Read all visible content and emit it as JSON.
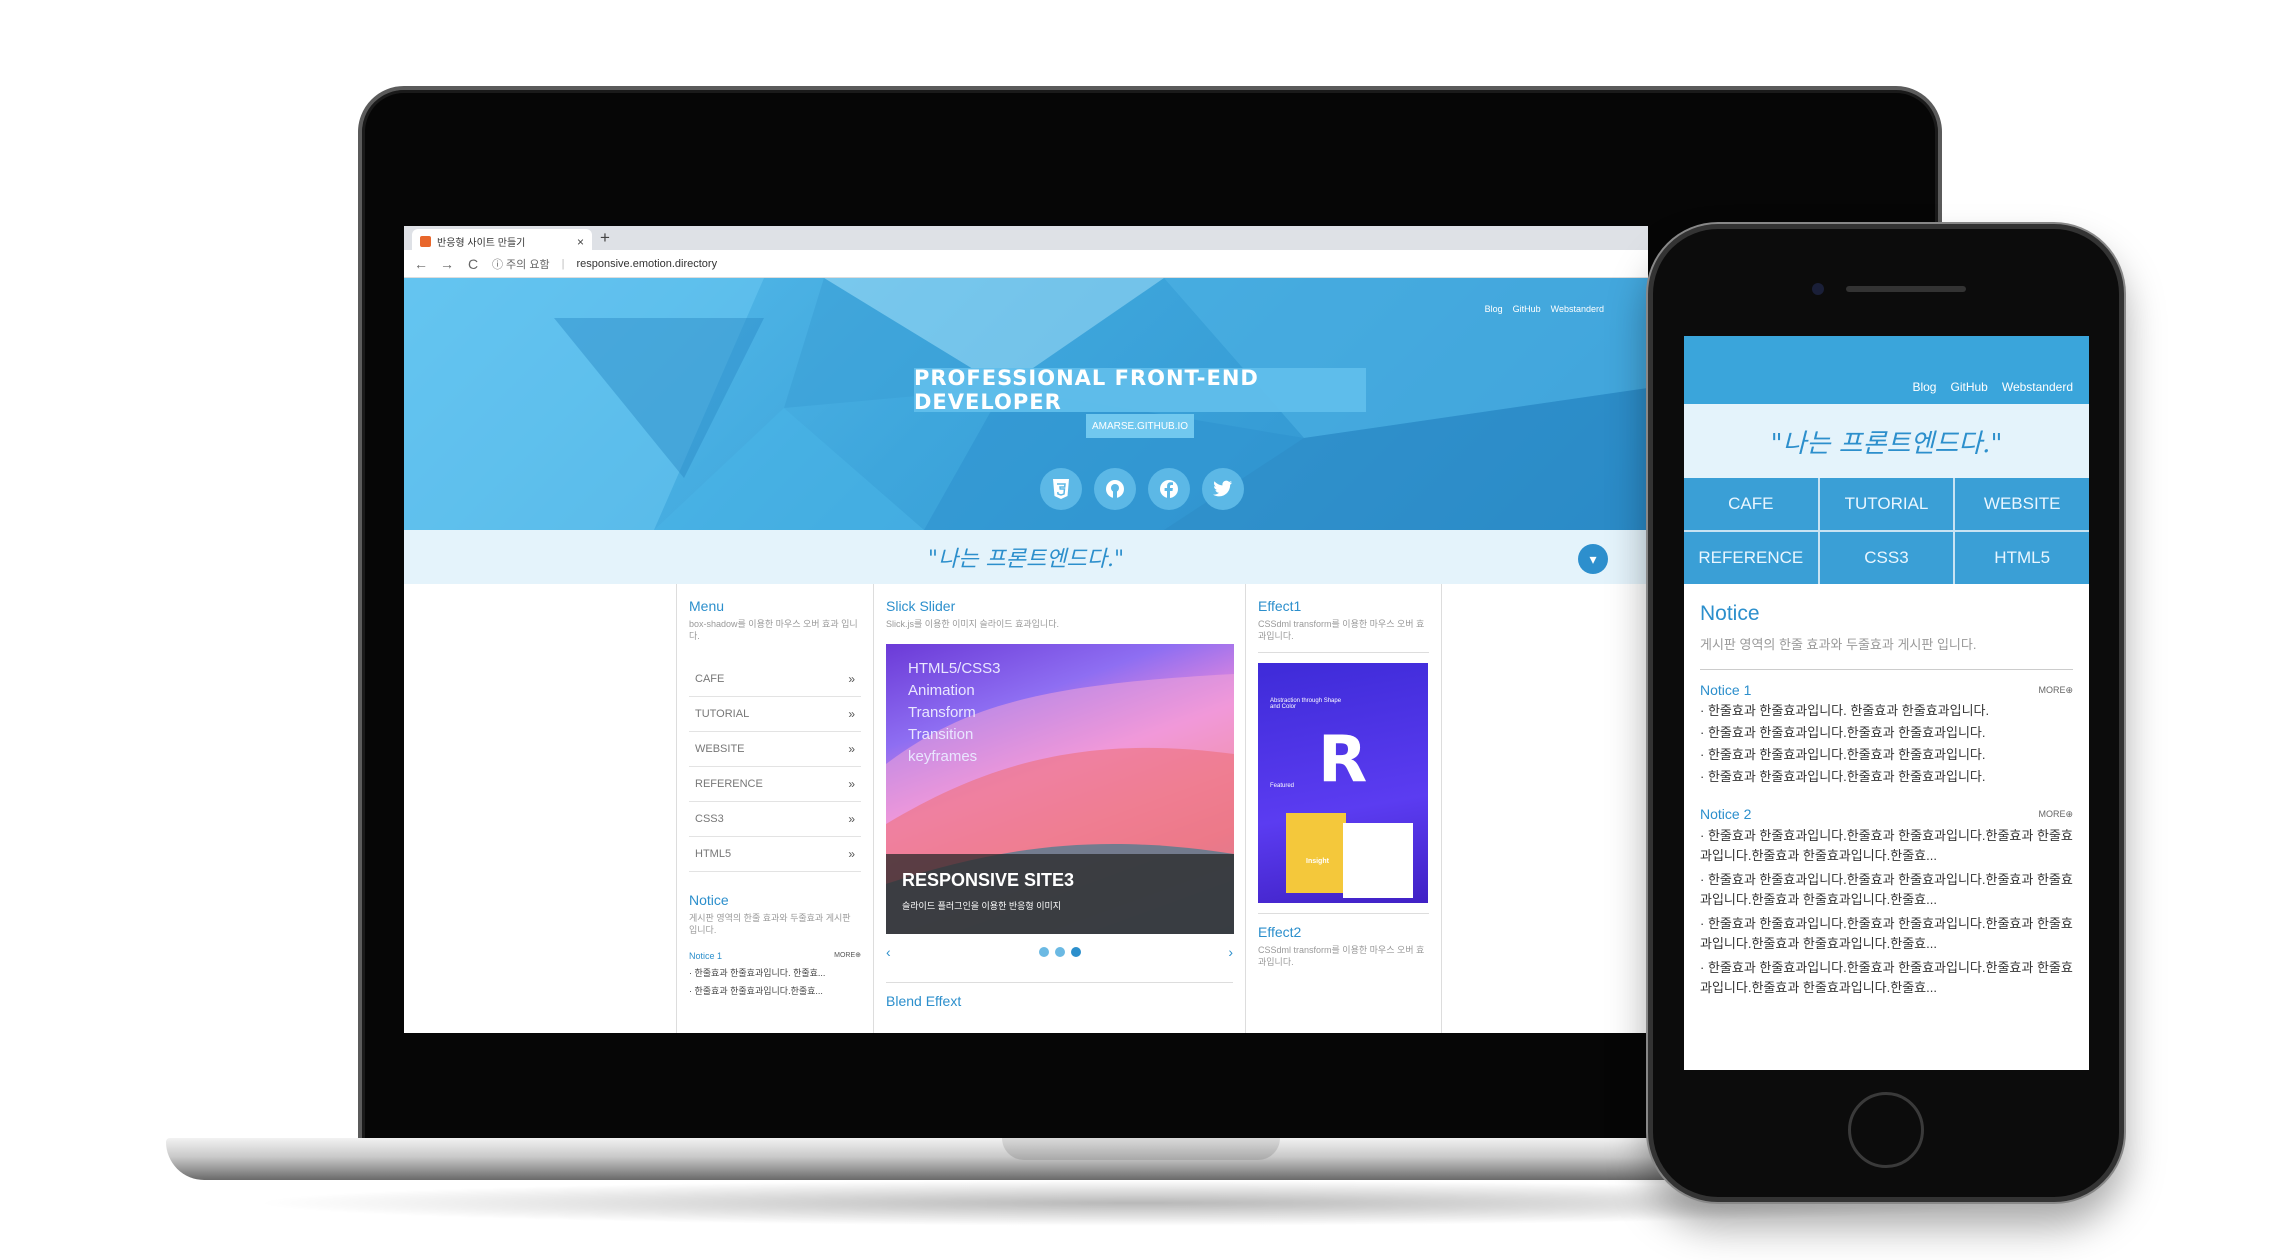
{
  "browser": {
    "tab_title": "반응형 사이트 만들기",
    "tab_close": "×",
    "new_tab": "+",
    "back": "←",
    "forward": "→",
    "reload": "C",
    "security_label": "ⓘ 주의 요함",
    "url_separator": "|",
    "url": "responsive.emotion.directory"
  },
  "site": {
    "links": [
      "Blog",
      "GitHub",
      "Webstanderd"
    ],
    "hero_title": "PROFESSIONAL FRONT-END DEVELOPER",
    "hero_subtitle": "AMARSE.GITHUB.IO",
    "social_icons": [
      "html5-icon",
      "github-icon",
      "facebook-icon",
      "twitter-icon"
    ],
    "slogan": "\"나는 프론트엔드다.\"",
    "toggle_icon": "chevron-down-icon"
  },
  "menu_box": {
    "title": "Menu",
    "desc": "box-shadow를 이용한 마우스 오버 효과 입니다.",
    "items": [
      "CAFE",
      "TUTORIAL",
      "WEBSITE",
      "REFERENCE",
      "CSS3",
      "HTML5"
    ],
    "arrow": "»"
  },
  "notice_box": {
    "title": "Notice",
    "desc": "게시판 영역의 한줄 효과와 두줄효과 게시판 입니다.",
    "sub_title": "Notice 1",
    "more": "MORE⊕",
    "lines": [
      "· 한줄효과 한줄효과입니다. 한줄효...",
      "· 한줄효과 한줄효과입니다.한줄효..."
    ]
  },
  "slider_box": {
    "title": "Slick Slider",
    "desc": "Slick.js를 이용한 이미지 슬라이드 효과입니다.",
    "image_lines": [
      "HTML5/CSS3",
      "Animation",
      "Transform",
      "Transition",
      "keyframes"
    ],
    "caption_title": "RESPONSIVE SITE3",
    "caption_sub": "슬라이드 플러그인을 이용한 반응형 이미지",
    "prev": "‹",
    "next": "›",
    "dots": 3,
    "active_dot": 2
  },
  "blend_box": {
    "title": "Blend  Effext"
  },
  "effect_box": {
    "title": "Effect1",
    "desc": "CSSdml transform를 이용한 마우스 오버 효과입니다.",
    "img_text": "Abstraction through Shape and Color",
    "img_featured": "Featured",
    "img_insight": "Insight",
    "title2": "Effect2",
    "desc2": "CSSdml transform를 이용한 마우스 오버 효과입니다."
  },
  "phone": {
    "links": [
      "Blog",
      "GitHub",
      "Webstanderd"
    ],
    "slogan": "\"나는 프론트엔드다.\"",
    "menu": [
      "CAFE",
      "TUTORIAL",
      "WEBSITE",
      "REFERENCE",
      "CSS3",
      "HTML5"
    ],
    "notice_title": "Notice",
    "notice_desc": "게시판 영역의 한줄 효과와 두줄효과 게시판 입니다.",
    "notice1_title": "Notice 1",
    "notice2_title": "Notice 2",
    "more": "MORE⊕",
    "notice1_rows": [
      "· 한줄효과 한줄효과입니다. 한줄효과 한줄효과입니다.",
      "· 한줄효과 한줄효과입니다.한줄효과 한줄효과입니다.",
      "· 한줄효과 한줄효과입니다.한줄효과 한줄효과입니다.",
      "· 한줄효과 한줄효과입니다.한줄효과 한줄효과입니다."
    ],
    "notice2_rows": [
      "· 한줄효과 한줄효과입니다.한줄효과 한줄효과입니다.한줄효과 한줄효과입니다.한줄효과 한줄효과입니다.한줄효...",
      "· 한줄효과 한줄효과입니다.한줄효과 한줄효과입니다.한줄효과 한줄효과입니다.한줄효과 한줄효과입니다.한줄효...",
      "· 한줄효과 한줄효과입니다.한줄효과 한줄효과입니다.한줄효과 한줄효과입니다.한줄효과 한줄효과입니다.한줄효...",
      "· 한줄효과 한줄효과입니다.한줄효과 한줄효과입니다.한줄효과 한줄효과입니다.한줄효과 한줄효과입니다.한줄효..."
    ]
  },
  "colors": {
    "accent": "#2c8fcc",
    "hero_light": "#5cc0ee",
    "slogan_bg": "#e4f3fb"
  }
}
